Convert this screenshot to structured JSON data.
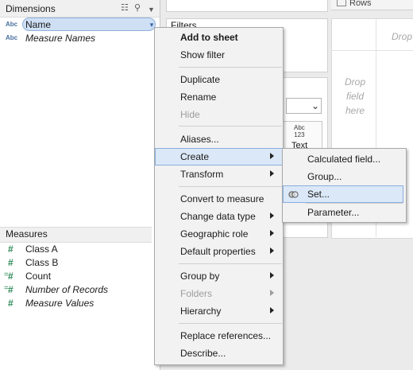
{
  "dimensions": {
    "title": "Dimensions",
    "fields": [
      {
        "type": "Abc",
        "label": "Name",
        "selected": true
      },
      {
        "type": "Abc",
        "label": "Measure Names",
        "italic": true
      }
    ]
  },
  "measures": {
    "title": "Measures",
    "fields": [
      {
        "label": "Class A"
      },
      {
        "label": "Class B"
      },
      {
        "label": "Count"
      },
      {
        "label": "Number of Records",
        "italic": true
      },
      {
        "label": "Measure Values",
        "italic": true
      }
    ]
  },
  "shelves": {
    "rows_label": "Rows",
    "filters_title": "Filters",
    "marks_text_type": "Abc\n123",
    "marks_text_label": "Text"
  },
  "canvas": {
    "drop_top": "Drop",
    "drop_side": "Drop\nfield\nhere"
  },
  "context_menu": {
    "items": [
      {
        "label": "Add to sheet",
        "bold": true
      },
      {
        "label": "Show filter"
      },
      {
        "label": "Duplicate"
      },
      {
        "label": "Rename"
      },
      {
        "label": "Hide",
        "disabled": true
      },
      {
        "label": "Aliases..."
      },
      {
        "label": "Create",
        "submenu": true,
        "highlighted": true
      },
      {
        "label": "Transform",
        "submenu": true
      },
      {
        "label": "Convert to measure"
      },
      {
        "label": "Change data type",
        "submenu": true
      },
      {
        "label": "Geographic role",
        "submenu": true
      },
      {
        "label": "Default properties",
        "submenu": true
      },
      {
        "label": "Group by",
        "submenu": true
      },
      {
        "label": "Folders",
        "submenu": true,
        "disabled": true
      },
      {
        "label": "Hierarchy",
        "submenu": true
      },
      {
        "label": "Replace references..."
      },
      {
        "label": "Describe..."
      }
    ]
  },
  "create_submenu": {
    "items": [
      {
        "label": "Calculated field..."
      },
      {
        "label": "Group..."
      },
      {
        "label": "Set...",
        "highlighted": true,
        "icon": "set-icon"
      },
      {
        "label": "Parameter..."
      }
    ]
  },
  "colors": {
    "highlight": "#dbe8f7",
    "highlight_border": "#89aede",
    "dimension_pill": "#cfe0f5",
    "measure_icon": "#2f8a5a",
    "dimension_icon": "#4a6fa0"
  }
}
